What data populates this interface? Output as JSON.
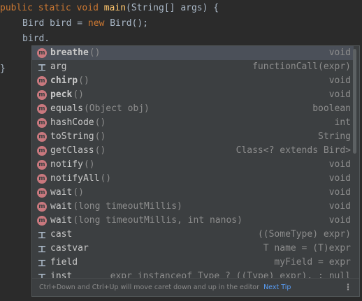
{
  "editor": {
    "line1": {
      "kw1": "public",
      "kw2": "static",
      "kw3": "void",
      "method": "main",
      "rest": "(String[] args) {"
    },
    "line2": {
      "part1": "Bird bird = ",
      "kw": "new",
      "part2": " Bird();"
    },
    "line3": "bird.",
    "closing_brace": "}"
  },
  "completion": {
    "items": [
      {
        "icon": "method-icon",
        "name": "breathe",
        "params": "()",
        "type": "void",
        "bold": true,
        "selected": true
      },
      {
        "icon": "template-icon",
        "name": "arg",
        "params": "",
        "type": "functionCall(expr)",
        "bold": false
      },
      {
        "icon": "method-icon",
        "name": "chirp",
        "params": "()",
        "type": "void",
        "bold": true
      },
      {
        "icon": "method-icon",
        "name": "peck",
        "params": "()",
        "type": "void",
        "bold": true
      },
      {
        "icon": "method-icon",
        "name": "equals",
        "params": "(Object obj)",
        "type": "boolean",
        "bold": false
      },
      {
        "icon": "method-icon",
        "name": "hashCode",
        "params": "()",
        "type": "int",
        "bold": false
      },
      {
        "icon": "method-icon",
        "name": "toString",
        "params": "()",
        "type": "String",
        "bold": false
      },
      {
        "icon": "method-icon",
        "name": "getClass",
        "params": "()",
        "type": "Class<? extends Bird>",
        "bold": false
      },
      {
        "icon": "method-icon",
        "name": "notify",
        "params": "()",
        "type": "void",
        "bold": false
      },
      {
        "icon": "method-icon",
        "name": "notifyAll",
        "params": "()",
        "type": "void",
        "bold": false
      },
      {
        "icon": "method-icon",
        "name": "wait",
        "params": "()",
        "type": "void",
        "bold": false
      },
      {
        "icon": "method-icon",
        "name": "wait",
        "params": "(long timeoutMillis)",
        "type": "void",
        "bold": false
      },
      {
        "icon": "method-icon",
        "name": "wait",
        "params": "(long timeoutMillis, int nanos)",
        "type": "void",
        "bold": false
      },
      {
        "icon": "template-icon",
        "name": "cast",
        "params": "",
        "type": "((SomeType) expr)",
        "bold": false
      },
      {
        "icon": "template-icon",
        "name": "castvar",
        "params": "",
        "type": "T name = (T)expr",
        "bold": false
      },
      {
        "icon": "template-icon",
        "name": "field",
        "params": "",
        "type": "myField = expr",
        "bold": false
      },
      {
        "icon": "template-icon",
        "name": "inst",
        "params": "",
        "type": "expr instanceof Type ? ((Type) expr). : null",
        "bold": false
      }
    ],
    "footer": {
      "hint": "Ctrl+Down and Ctrl+Up will move caret down and up in the editor",
      "link": "Next Tip",
      "more": "⋮"
    }
  },
  "colors": {
    "background": "#2b2b2b",
    "popup": "#3c3f41",
    "selected": "#4b5059",
    "keyword": "#cc7832",
    "method_decl": "#ffc66d",
    "method_icon": "#c9787e",
    "link": "#589df6"
  }
}
